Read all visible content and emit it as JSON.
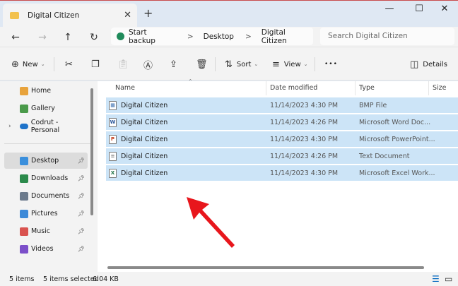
{
  "window": {
    "tab_title": "Digital Citizen",
    "close_tab": "✕",
    "new_tab": "+",
    "minimize": "—",
    "maximize": "☐",
    "close": "✕"
  },
  "address": {
    "back": "←",
    "forward": "→",
    "up": "↑",
    "refresh": "↻",
    "start_backup": "Start backup",
    "crumbs": [
      "Desktop",
      "Digital Citizen"
    ],
    "separator": ">",
    "search_placeholder": "Search Digital Citizen"
  },
  "toolbar": {
    "new_label": "New",
    "sort_label": "Sort",
    "view_label": "View",
    "more": "•••",
    "details_label": "Details"
  },
  "sidebar": {
    "items": [
      {
        "label": "Home",
        "icon": "home-icon",
        "color": "#e8a33c"
      },
      {
        "label": "Gallery",
        "icon": "gallery-icon",
        "color": "#4a9a4a"
      },
      {
        "label": "Codrut - Personal",
        "icon": "onedrive-icon",
        "color": "#1e73c9"
      },
      {
        "label": "Desktop",
        "icon": "desktop-icon",
        "color": "#3a8fdc"
      },
      {
        "label": "Downloads",
        "icon": "downloads-icon",
        "color": "#2b8a4b"
      },
      {
        "label": "Documents",
        "icon": "documents-icon",
        "color": "#6b7a8c"
      },
      {
        "label": "Pictures",
        "icon": "pictures-icon",
        "color": "#3d8ad8"
      },
      {
        "label": "Music",
        "icon": "music-icon",
        "color": "#d9534f"
      },
      {
        "label": "Videos",
        "icon": "videos-icon",
        "color": "#7b4fc9"
      }
    ]
  },
  "columns": {
    "name": "Name",
    "date": "Date modified",
    "type": "Type",
    "size": "Size"
  },
  "files": [
    {
      "name": "Digital Citizen",
      "date": "11/14/2023 4:30 PM",
      "type": "BMP File",
      "icon": "bmp-file-icon",
      "glyph": "▦",
      "color": "#3a6fb0"
    },
    {
      "name": "Digital Citizen",
      "date": "11/14/2023 4:26 PM",
      "type": "Microsoft Word Doc...",
      "icon": "word-file-icon",
      "glyph": "W",
      "color": "#2b579a"
    },
    {
      "name": "Digital Citizen",
      "date": "11/14/2023 4:30 PM",
      "type": "Microsoft PowerPoint...",
      "icon": "powerpoint-file-icon",
      "glyph": "P",
      "color": "#c43e1c"
    },
    {
      "name": "Digital Citizen",
      "date": "11/14/2023 4:26 PM",
      "type": "Text Document",
      "icon": "text-file-icon",
      "glyph": "≡",
      "color": "#777777"
    },
    {
      "name": "Digital Citizen",
      "date": "11/14/2023 4:30 PM",
      "type": "Microsoft Excel Work...",
      "icon": "excel-file-icon",
      "glyph": "X",
      "color": "#217346"
    }
  ],
  "status": {
    "items": "5 items",
    "selected": "5 items selected",
    "size": "6.04 KB"
  },
  "colors": {
    "selection": "#cce4f7",
    "accent": "#0067c0",
    "annotation_arrow": "#e8161c"
  }
}
